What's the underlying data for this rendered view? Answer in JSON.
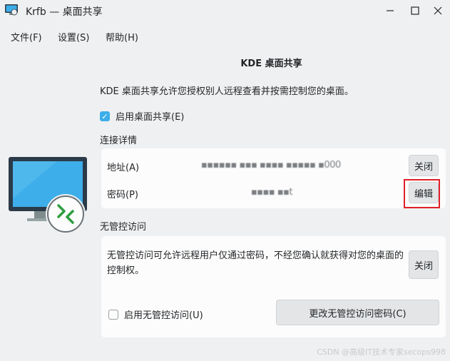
{
  "window": {
    "title": "Krfb — 桌面共享"
  },
  "menu": {
    "file": "文件(F)",
    "settings": "设置(S)",
    "help": "帮助(H)"
  },
  "main": {
    "heading": "KDE 桌面共享",
    "description": "KDE 桌面共享允许您授权别人远程查看并按需控制您的桌面。",
    "enable_label": "启用桌面共享(E)",
    "enable_checked": true
  },
  "connection": {
    "section_label": "连接详情",
    "address_label": "地址(A)",
    "address_value": "▪▪▪▪▪▪ ▪▪▪ ▪▪▪▪ ▪▪▪▪▪ ▪000",
    "address_button": "关闭",
    "password_label": "密码(P)",
    "password_value": "▪▪▪▪ ▪▪t",
    "password_button": "编辑"
  },
  "unattended": {
    "section_label": "无管控访问",
    "description": "无管控访问可允许远程用户仅通过密码，不经您确认就获得对您的桌面的控制权。",
    "close_button": "关闭",
    "enable_label": "启用无管控访问(U)",
    "enable_checked": false,
    "change_password_button": "更改无管控访问密码(C)"
  },
  "watermark": "CSDN @高级IT技术专家secops998",
  "colors": {
    "accent": "#3daee9",
    "monitor_screen": "#3daee9",
    "highlight": "#e0202a",
    "arrows": "#2e9e40"
  }
}
